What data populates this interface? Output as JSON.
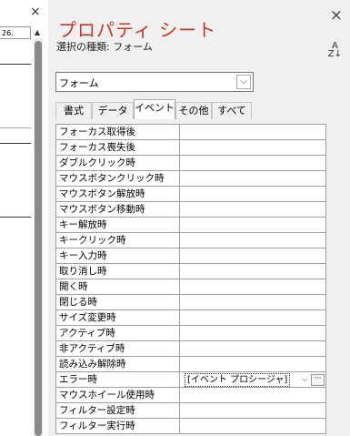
{
  "left": {
    "close": "×",
    "field_value": "26."
  },
  "sheet": {
    "title": "プロパティ シート",
    "selection_type": "選択の種類: フォーム",
    "close": "×",
    "sort_icon_top": "A",
    "sort_icon_bottom": "Z↓",
    "object_combo": "フォーム",
    "tabs": [
      "書式",
      "データ",
      "イベント",
      "その他",
      "すべて"
    ],
    "active_tab": "イベント",
    "rows": [
      {
        "label": "フォーカス取得後",
        "value": ""
      },
      {
        "label": "フォーカス喪失後",
        "value": ""
      },
      {
        "label": "ダブルクリック時",
        "value": ""
      },
      {
        "label": "マウスボタンクリック時",
        "value": ""
      },
      {
        "label": "マウスボタン解放時",
        "value": ""
      },
      {
        "label": "マウスボタン移動時",
        "value": ""
      },
      {
        "label": "キー解放時",
        "value": ""
      },
      {
        "label": "キークリック時",
        "value": ""
      },
      {
        "label": "キー入力時",
        "value": ""
      },
      {
        "label": "取り消し時",
        "value": ""
      },
      {
        "label": "開く時",
        "value": ""
      },
      {
        "label": "閉じる時",
        "value": ""
      },
      {
        "label": "サイズ変更時",
        "value": ""
      },
      {
        "label": "アクティブ時",
        "value": ""
      },
      {
        "label": "非アクティブ時",
        "value": ""
      },
      {
        "label": "読み込み解除時",
        "value": ""
      },
      {
        "label": "エラー時",
        "value": "[イベント プロシージャ]"
      },
      {
        "label": "マウスホイール使用時",
        "value": ""
      },
      {
        "label": "フィルター設定時",
        "value": ""
      },
      {
        "label": "フィルター実行時",
        "value": ""
      }
    ],
    "builder_button": "···"
  }
}
